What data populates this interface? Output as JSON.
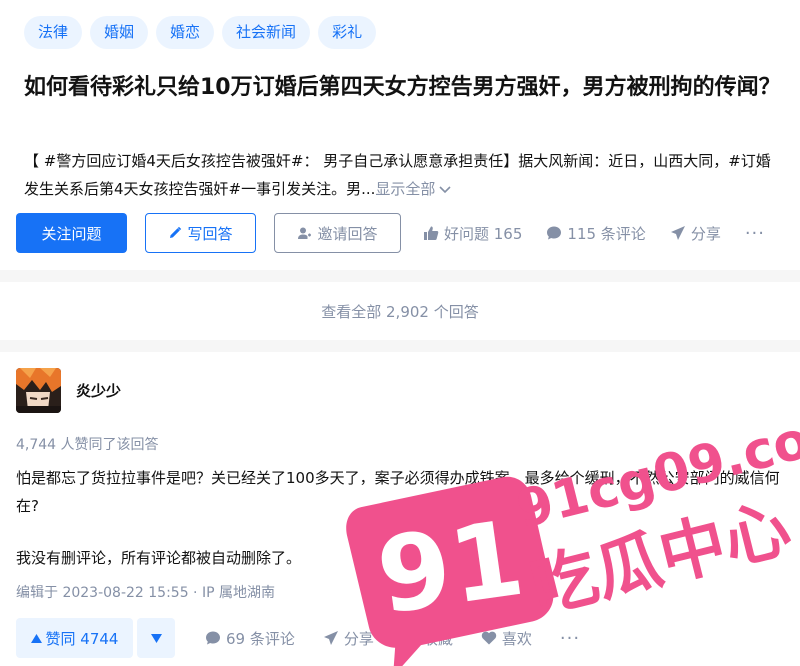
{
  "question": {
    "topics": [
      "法律",
      "婚姻",
      "婚恋",
      "社会新闻",
      "彩礼"
    ],
    "title": "如何看待彩礼只给10万订婚后第四天女方控告男方强奸，男方被刑拘的传闻？",
    "excerpt": "【 #警方回应订婚4天后女孩控告被强奸#： 男子自己承认愿意承担责任】据大风新闻：近日，山西大同，#订婚发生关系后第4天女孩控告强奸#一事引发关注。男...",
    "show_all": "显示全部",
    "actions": {
      "follow": "关注问题",
      "write": "写回答",
      "invite": "邀请回答",
      "good_question": "好问题 165",
      "comments": "115 条评论",
      "share": "分享",
      "more": "···"
    }
  },
  "view_all": "查看全部 2,902 个回答",
  "answer": {
    "author": "炎少少",
    "vote_summary": "4,744 人赞同了该回答",
    "paragraph1": "怕是都忘了货拉拉事件是吧？关已经关了100多天了，案子必须得办成铁案，最多给个缓刑，不然公安部门的威信何在?",
    "paragraph2": "我没有删评论，所有评论都被自动删除了。",
    "edited": "编辑于 2023-08-22 15:55 · IP 属地湖南",
    "actions": {
      "vote_up": "赞同 4744",
      "comments": "69 条评论",
      "share": "分享",
      "collect": "收藏",
      "like": "喜欢",
      "more": "···"
    }
  },
  "watermark": {
    "logo_number": "91",
    "site": "91cg09.com",
    "slogan": "吃瓜中心"
  },
  "colors": {
    "primary": "#1772f6",
    "muted": "#8590a6",
    "watermark_pink": "#f0518d"
  }
}
